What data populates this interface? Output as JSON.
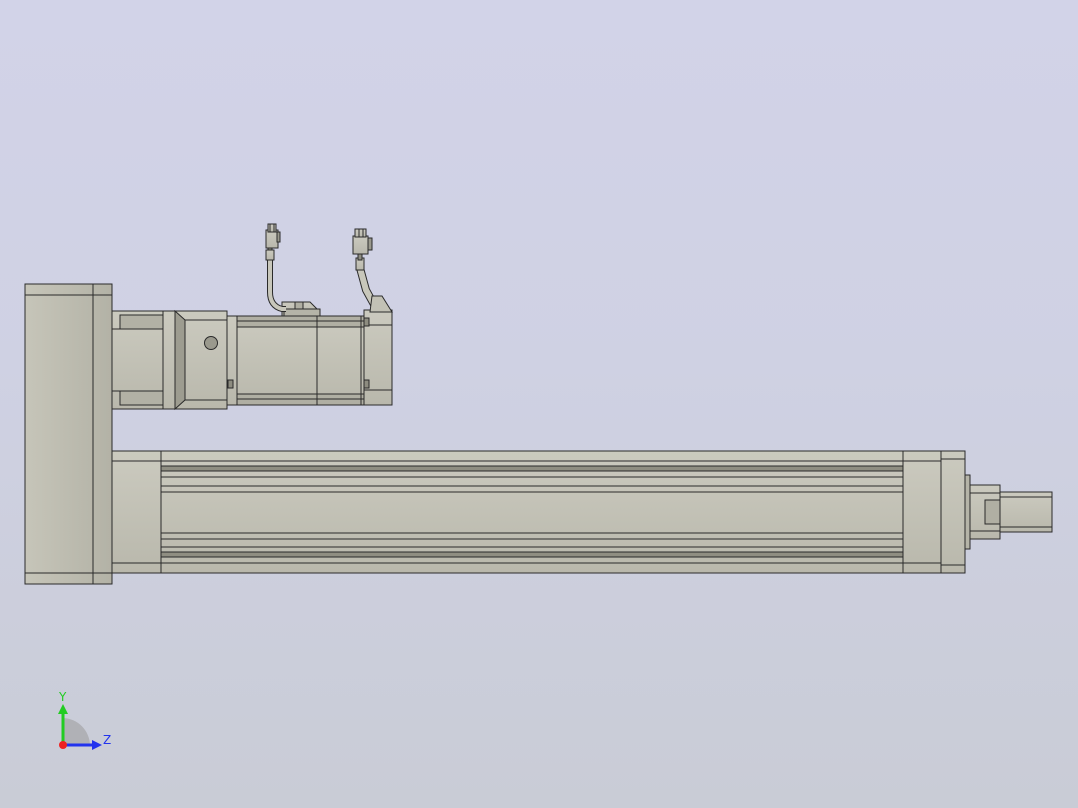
{
  "triad": {
    "y_label": "Y",
    "z_label": "Z",
    "y_color": "#22cc22",
    "z_color": "#2233ee",
    "x_color": "#ee2222"
  },
  "colors": {
    "background_top": "#d2d3e8",
    "background_bottom": "#c9ccd6",
    "part_fill": "#c2c1b5",
    "part_fill_dark": "#a9a89c",
    "edge": "#2a2a2a"
  },
  "model": {
    "view": "side",
    "components": [
      "base-plate",
      "gearbox",
      "servo-motor",
      "motor-cable-left",
      "motor-cable-right",
      "actuator-body",
      "rod-end"
    ]
  }
}
